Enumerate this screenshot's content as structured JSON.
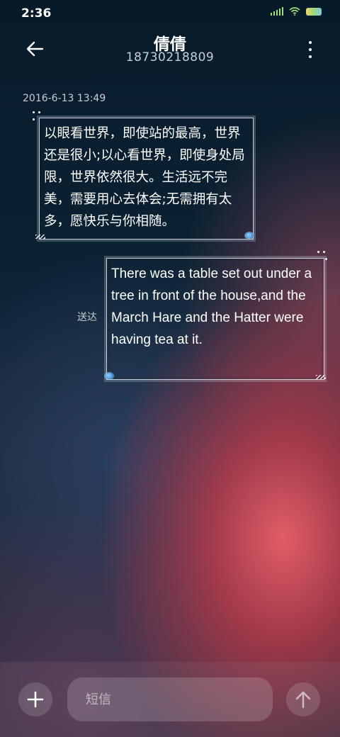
{
  "status_bar": {
    "time": "2:36"
  },
  "header": {
    "contact_name": "倩倩",
    "contact_number": "18730218809",
    "back_icon": "arrow-left-icon",
    "more_icon": "more-vertical-icon"
  },
  "conversation": {
    "timestamp": "2016-6-13 13:49",
    "messages": [
      {
        "direction": "incoming",
        "text": "以眼看世界，即使站的最高，世界还是很小;以心看世界，即使身处局限，世界依然很大。生活远不完美，需要用心去体会;无需拥有太多，愿快乐与你相随。"
      },
      {
        "direction": "outgoing",
        "text": "There was a table set out under a tree in front of the house,and the March Hare and the Hatter were having tea at it.",
        "status": "送达"
      }
    ]
  },
  "composer": {
    "placeholder": "短信",
    "add_icon": "plus-icon",
    "send_icon": "arrow-up-icon"
  },
  "colors": {
    "text": "#ffffff",
    "muted_text": "#c8ccd3",
    "accent_glow": "#ec6068"
  }
}
